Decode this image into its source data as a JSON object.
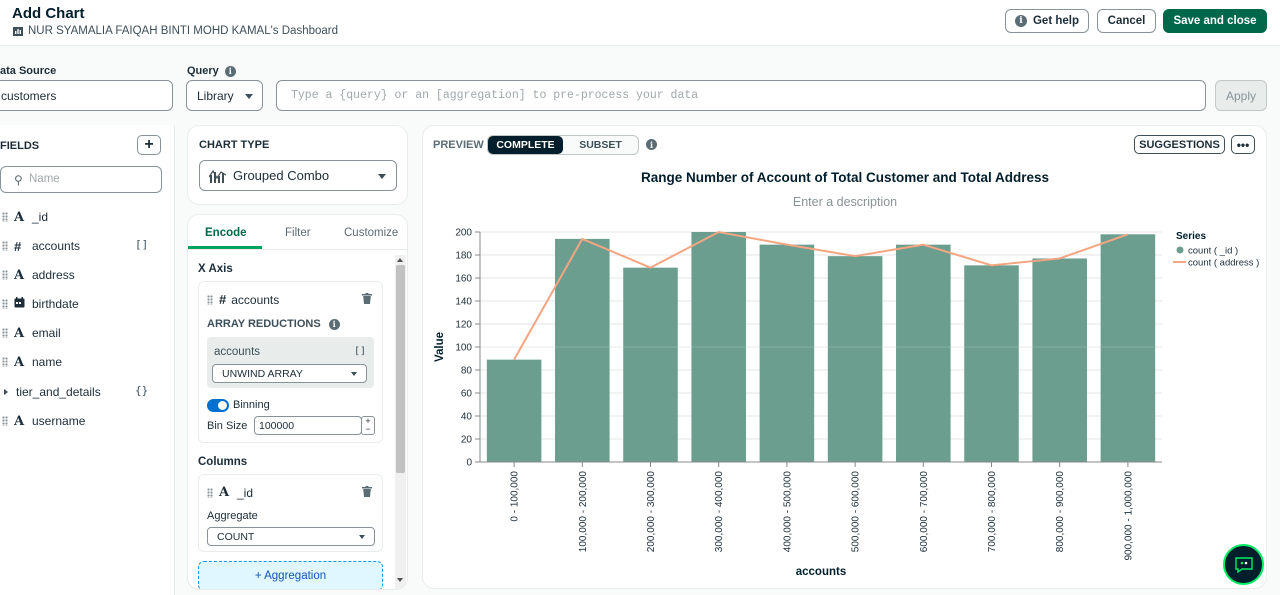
{
  "header": {
    "title": "Add Chart",
    "dashboard": "NUR SYAMALIA FAIQAH BINTI MOHD KAMAL's Dashboard",
    "help_label": "Get help",
    "cancel_label": "Cancel",
    "save_label": "Save and close"
  },
  "data_source": {
    "label": "ata Source",
    "value": "customers"
  },
  "query": {
    "label": "Query",
    "library_label": "Library",
    "placeholder": "Type a {query} or an [aggregation] to pre-process your data",
    "apply_label": "Apply"
  },
  "fields": {
    "title": "FIELDS",
    "search_placeholder": "Name",
    "items": [
      {
        "type": "A",
        "name": "_id",
        "suffix": ""
      },
      {
        "type": "#",
        "name": "accounts",
        "suffix": "[]"
      },
      {
        "type": "A",
        "name": "address",
        "suffix": ""
      },
      {
        "type": "date",
        "name": "birthdate",
        "suffix": ""
      },
      {
        "type": "A",
        "name": "email",
        "suffix": ""
      },
      {
        "type": "A",
        "name": "name",
        "suffix": ""
      },
      {
        "type": "obj",
        "name": "tier_and_details",
        "suffix": "{}"
      },
      {
        "type": "A",
        "name": "username",
        "suffix": ""
      }
    ]
  },
  "chart_type": {
    "title": "CHART TYPE",
    "value": "Grouped Combo"
  },
  "encode": {
    "tabs": [
      "Encode",
      "Filter",
      "Customize"
    ],
    "x_axis_title": "X Axis",
    "x_field": "accounts",
    "array_reductions_label": "ARRAY REDUCTIONS",
    "array_field": "accounts",
    "array_suffix": "[]",
    "array_option": "UNWIND ARRAY",
    "binning_label": "Binning",
    "bin_size_label": "Bin Size",
    "bin_size_value": "100000",
    "columns_title": "Columns",
    "column_field": "_id",
    "aggregate_label": "Aggregate",
    "aggregate_value": "COUNT",
    "add_aggregation": "+ Aggregation"
  },
  "preview": {
    "label": "PREVIEW",
    "seg_complete": "COMPLETE",
    "seg_subset": "SUBSET",
    "suggestions_label": "SUGGESTIONS",
    "more_label": "•••"
  },
  "chart_data": {
    "type": "bar",
    "title": "Range Number of Account of Total Customer and Total Address",
    "description_placeholder": "Enter a description",
    "xlabel": "accounts",
    "ylabel": "Value",
    "ylim": [
      0,
      200
    ],
    "yticks": [
      0,
      20,
      40,
      60,
      80,
      100,
      120,
      140,
      160,
      180,
      200
    ],
    "categories": [
      "0 - 100,000",
      "100,000 - 200,000",
      "200,000 - 300,000",
      "300,000 - 400,000",
      "400,000 - 500,000",
      "500,000 - 600,000",
      "600,000 - 700,000",
      "700,000 - 800,000",
      "800,000 - 900,000",
      "900,000 - 1,000,000"
    ],
    "legend_title": "Series",
    "legend_position": "right",
    "series": [
      {
        "name": "count ( _id )",
        "kind": "bar",
        "color": "#6b9e8f",
        "values": [
          89,
          194,
          169,
          201,
          189,
          179,
          189,
          171,
          177,
          198
        ]
      },
      {
        "name": "count ( address )",
        "kind": "line",
        "color": "#f4a582",
        "values": [
          89,
          194,
          169,
          201,
          189,
          179,
          189,
          171,
          177,
          198
        ]
      }
    ],
    "grid": true
  }
}
